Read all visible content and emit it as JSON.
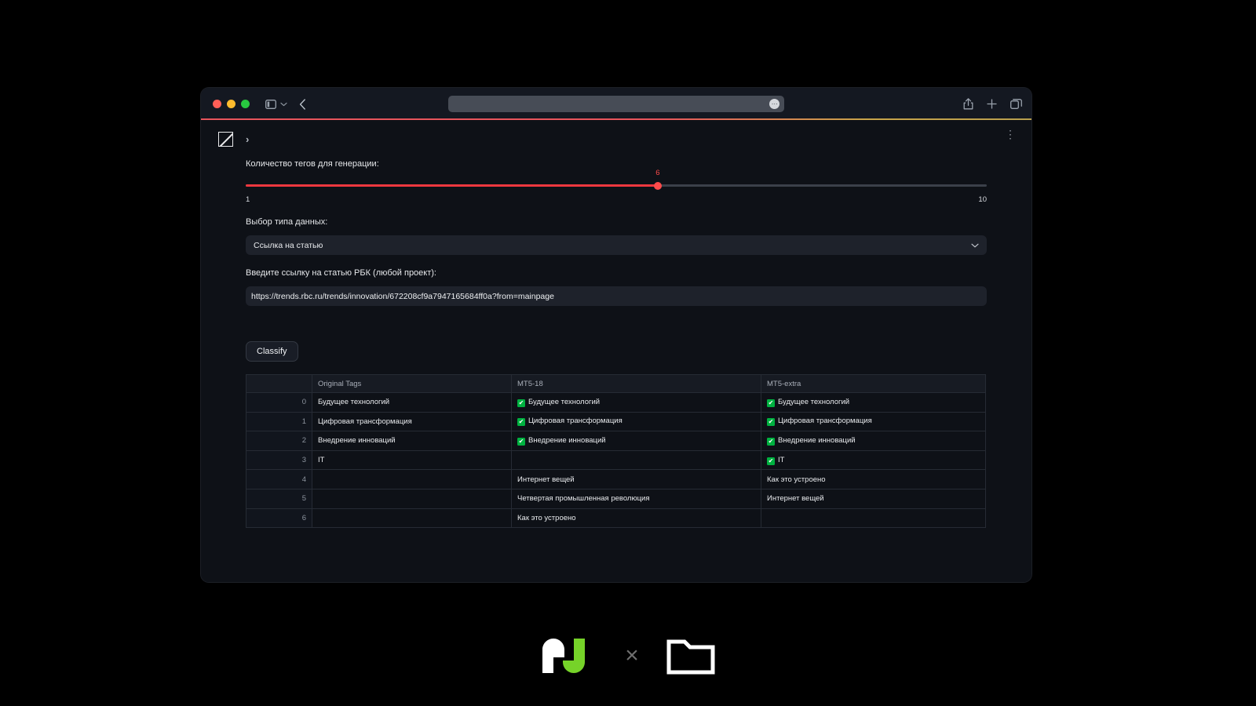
{
  "browser": {
    "traffic_lights": [
      "close",
      "minimize",
      "maximize"
    ],
    "address_value": "",
    "address_placeholder": "",
    "extension_badge": "⋯",
    "back_label": "Back",
    "sidebar_label": "Show Sidebar",
    "share_label": "Share",
    "new_tab_label": "New Tab",
    "tab_overview_label": "Tab Overview"
  },
  "app": {
    "menu_glyph": "⋮",
    "expand_glyph": "›",
    "slider": {
      "label": "Количество тегов для генерации:",
      "value": "6",
      "min": "1",
      "max": "10",
      "fill_percent": 55.6,
      "accent_color": "#ff4b4b"
    },
    "select": {
      "label": "Выбор типа данных:",
      "value": "Ссылка на статью",
      "chevron": "⌄"
    },
    "url_input": {
      "label": "Введите ссылку на статью РБК (любой проект):",
      "value": "https://trends.rbc.ru/trends/innovation/672208cf9a7947165684ff0a?from=mainpage",
      "placeholder": ""
    },
    "classify_button": "Classify",
    "table": {
      "columns": [
        "",
        "Original Tags",
        "MT5-18",
        "MT5-extra"
      ],
      "rows": [
        {
          "index": "0",
          "original": "Будущее технологий",
          "mt5_18": "Будущее технологий",
          "mt5_18_check": true,
          "mt5_extra": "Будущее технологий",
          "mt5_extra_check": true
        },
        {
          "index": "1",
          "original": "Цифровая трансформация",
          "mt5_18": "Цифровая трансформация",
          "mt5_18_check": true,
          "mt5_extra": "Цифровая трансформация",
          "mt5_extra_check": true
        },
        {
          "index": "2",
          "original": "Внедрение инноваций",
          "mt5_18": "Внедрение инноваций",
          "mt5_18_check": true,
          "mt5_extra": "Внедрение инноваций",
          "mt5_extra_check": true
        },
        {
          "index": "3",
          "original": "IT",
          "mt5_18": "",
          "mt5_18_check": false,
          "mt5_extra": "IT",
          "mt5_extra_check": true
        },
        {
          "index": "4",
          "original": "",
          "mt5_18": "Интернет вещей",
          "mt5_18_check": false,
          "mt5_extra": "Как это устроено",
          "mt5_extra_check": false
        },
        {
          "index": "5",
          "original": "",
          "mt5_18": "Четвертая промышленная революция",
          "mt5_18_check": false,
          "mt5_extra": "Интернет вещей",
          "mt5_extra_check": false
        },
        {
          "index": "6",
          "original": "",
          "mt5_18": "Как это устроено",
          "mt5_18_check": false,
          "mt5_extra": "",
          "mt5_extra_check": false
        }
      ]
    }
  },
  "footer": {
    "cross_glyph": "×",
    "brand_colors": {
      "white": "#ffffff",
      "green": "#76d329"
    },
    "folder_color": "#ffffff"
  }
}
